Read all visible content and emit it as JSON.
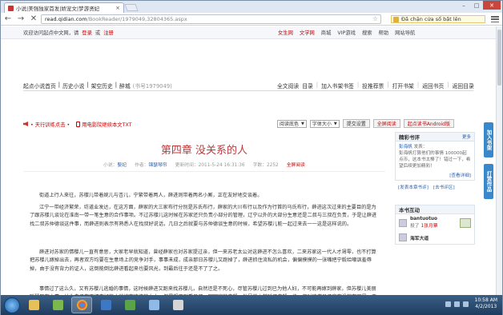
{
  "browser": {
    "tab_title": "小说|美强独家首发|娇宠文|梦游贤妃",
    "tab_close": "×",
    "address_host": "read.qidian.com",
    "address_path": "/BookReader/1979049,32804365.aspx",
    "extension_text": "Đã chặn cửa sổ bật lên",
    "nav_back": "←",
    "nav_forward": "→",
    "nav_reload": "✕",
    "nav_home": "⌂",
    "min": "–",
    "max": "□",
    "close": "✕"
  },
  "topbar": {
    "welcome": "欢迎访问起点中文网，请",
    "login": "登录",
    "or": "或",
    "register": "注册",
    "nav": [
      "女生网",
      "文学网",
      "商城",
      "VIP游戏",
      "搜索",
      "帮助",
      "网站导航"
    ]
  },
  "breadcrumb": {
    "items": [
      "起点小说首页",
      "历史小说",
      "架空历史",
      "醉城"
    ],
    "book_no": "(书号1979049)"
  },
  "topmenu": [
    "全文阅读",
    "目录",
    "加入书架书签",
    "投推荐票",
    "打开书架",
    "返回书页",
    "返回目录"
  ],
  "toolbar": {
    "promo": "• 天行训练点击 •",
    "phone_link": "用电影院继续本文TXT",
    "bg_select": "阅读底色",
    "size_select": "字体大小",
    "submit_btn": "提交设置",
    "fullscreen_btn": "全屏阅读",
    "android_btn": "起点读书Android版"
  },
  "chapter": {
    "title": "第四章 没关系的人",
    "meta_label_book": "小说：",
    "book": "娶妃",
    "meta_label_author": "作者：",
    "author": "锦瑟琴帘",
    "meta_label_time": "更新时间：",
    "updated": "2011-5-24 16:31:36",
    "meta_label_words": "字数：",
    "words": "2252",
    "fullscreen": "全屏阅读"
  },
  "paragraphs": [
    "街道上行人来往，苏櫻儿带着婉儿与杏儿，宁繁带着两人，薛进则带着两名小厮，正在友好地交谈着。",
    "江宁一带经济繁荣，坊道业发达，在这方面，薛家的大三家布行分别是苏氏布行，薛家的大川布行以及作为行首的乌氏布行，薛进这次过来的主要目的是为了跟苏櫻儿谈论在淮南一带一笔生意的合作事项。不过苏櫻儿这时候在苏家还只负责小部分的管理，辽宁以外的大部分生意还是二叔与三叔在负责，于是让薛进找二叔苏仲德谈这件事，而薛进则表示有熟悉人在找叔好说话，几日之后就要与苏仲德谈生意的时候，希望苏櫻儿能一起过来去一一这是这样说的。",
    "薛进对苏家的情櫻儿一直有意思，大家老早就知道，曾经薛家也对苏家提过亲，但一来苏老太公对这薛进不怎么喜欢，二来苏家这一代人才凋零，也不打算把苏櫻儿嫁掉出去，再者双方均要在生意场上的竞争对手，事事未成，成亲那日苏櫻儿又跑掉了，薛进抓住流私的机会，偏偏摸摸的一张嘴把宁毅给嘲讽羞辱掉，由于没有背力的证人，这倒能倒比薛进看起来也要风光，到最后往于还是不了了之。",
    "事情过了这么久，又有苏櫻儿逃婚的事情，这时候薛进又跑来找苏櫻儿，自然还是不死心，尽管苏櫻儿过到已为他人妇，不可能再嫁到薛家，但苏櫻儿美丽聪慧又有本事，认为自己有再把它好的人就嫁在这边的女人，倒是想不到看见了一回回家的宁毅，他虽然之前睡了宁毅一块，但对这书呆子实在没放在眼里，于是跑过来主动打招呼，准备让宁毅想眼一番。"
  ],
  "sidebar": {
    "review_title": "精彩书评",
    "review_more": "更多",
    "review_user": "彭海帆",
    "review_date": "发表：",
    "review_text": "彭海帆打算他们的事情 100000起点币，这本书太棒了！错过一下，希望后续更加精彩！",
    "review_viewall": "[查看详细]",
    "link_post": "[发表本章书评]",
    "link_review": "[去书评区]",
    "interact_title": "本书互动",
    "fan1_name": "bantuotuo",
    "fan1_action": "投了",
    "fan1_votes": "1张月票",
    "fan2_name": "海军大道",
    "float_bookshelf": "加入书架",
    "float_reward": "打赏作品"
  },
  "taskbar": {
    "time": "10:58 AM",
    "date": "4/2/2013"
  }
}
